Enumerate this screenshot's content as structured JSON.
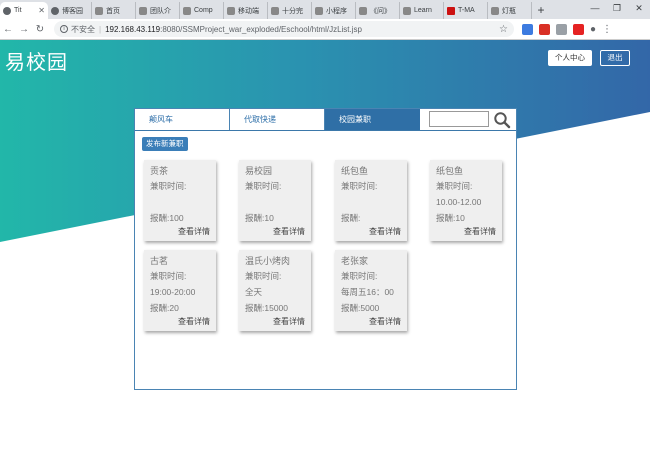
{
  "browser": {
    "tabs": [
      {
        "label": "Tit",
        "active": true
      },
      {
        "label": "博客园",
        "active": false
      },
      {
        "label": "首页",
        "active": false
      },
      {
        "label": "团队介",
        "active": false
      },
      {
        "label": "Comp",
        "active": false
      },
      {
        "label": "移动端",
        "active": false
      },
      {
        "label": "十分完",
        "active": false
      },
      {
        "label": "小程序",
        "active": false
      },
      {
        "label": "《问》",
        "active": false
      },
      {
        "label": "Learn",
        "active": false
      },
      {
        "label": "T-MA",
        "active": false
      },
      {
        "label": "灯瓶",
        "active": false
      }
    ],
    "new_tab": "+",
    "address": {
      "security": "不安全",
      "host": "192.168.43.119",
      "path": ":8080/SSMProject_war_exploded/Eschool/html/JzList.jsp"
    },
    "ext_colors": [
      "#3c7be0",
      "#d93025",
      "#9aa0a6",
      "#e52222"
    ]
  },
  "site": {
    "logo": "易校园",
    "personal_center": "个人中心",
    "logout": "退出"
  },
  "nav": {
    "tabs": [
      "颠风车",
      "代取快递",
      "校园兼职"
    ],
    "active_index": 2,
    "search_placeholder": ""
  },
  "publish_label": "发布新兼职",
  "jobs": [
    {
      "name": "贡茶",
      "time_label": "兼职时间:",
      "time": "",
      "pay": "报酬:100",
      "detail": "查看详情"
    },
    {
      "name": "易校园",
      "time_label": "兼职时间:",
      "time": "",
      "pay": "报酬:10",
      "detail": "查看详情"
    },
    {
      "name": "纸包鱼",
      "time_label": "兼职时间:",
      "time": "",
      "pay": "报酬:",
      "detail": "查看详情"
    },
    {
      "name": "纸包鱼",
      "time_label": "兼职时间:",
      "time": "10.00-12.00",
      "pay": "报酬:10",
      "detail": "查看详情"
    },
    {
      "name": "古茗",
      "time_label": "兼职时间:",
      "time": "19:00-20:00",
      "pay": "报酬:20",
      "detail": "查看详情"
    },
    {
      "name": "温氏小烤肉",
      "time_label": "兼职时间:",
      "time": "全天",
      "pay": "报酬:15000",
      "detail": "查看详情"
    },
    {
      "name": "老张家",
      "time_label": "兼职时间:",
      "time": "每周五16：00",
      "pay": "报酬:5000",
      "detail": "查看详情"
    }
  ],
  "colors": {
    "teal": "#20b5a8",
    "blue": "#2f6fa6",
    "accent": "#3b7eb8"
  }
}
